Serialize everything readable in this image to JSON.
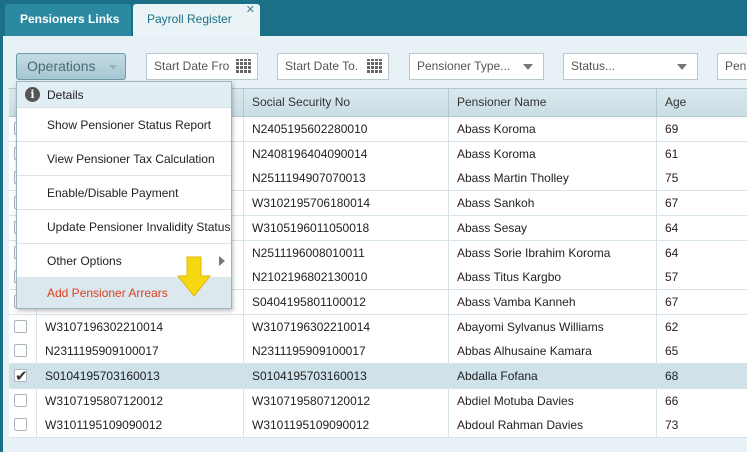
{
  "tabs": [
    {
      "label": "Pensioners Links"
    },
    {
      "label": "Payroll Register",
      "close": "✕"
    }
  ],
  "toolbar": {
    "operations_label": "Operations",
    "start_date_from_placeholder": "Start Date Fro",
    "start_date_to_placeholder": "Start Date To.",
    "pensioner_type_placeholder": "Pensioner Type...",
    "status_placeholder": "Status...",
    "last_field_placeholder": "Pens"
  },
  "grid": {
    "columns": [
      "Social Security No",
      "Pensioner Name",
      "Age"
    ],
    "rows": [
      {
        "ref": "",
        "ssn": "N2405195602280010",
        "name": "Abass Koroma",
        "age": "69",
        "checked": false
      },
      {
        "ref": "",
        "ssn": "N2408196404090014",
        "name": "Abass Koroma",
        "age": "61",
        "checked": false
      },
      {
        "ref": "",
        "ssn": "N2511194907070013",
        "name": "Abass Martin Tholley",
        "age": "75",
        "checked": false
      },
      {
        "ref": "",
        "ssn": "W3102195706180014",
        "name": "Abass Sankoh",
        "age": "67",
        "checked": false
      },
      {
        "ref": "",
        "ssn": "W3105196011050018",
        "name": "Abass Sesay",
        "age": "64",
        "checked": false
      },
      {
        "ref": "",
        "ssn": "N2511196008010011",
        "name": "Abass Sorie Ibrahim Koroma",
        "age": "64",
        "checked": false
      },
      {
        "ref": "",
        "ssn": "N2102196802130010",
        "name": "Abass Titus Kargbo",
        "age": "57",
        "checked": false
      },
      {
        "ref": "S0404195801100012",
        "ssn": "S0404195801100012",
        "name": "Abass Vamba Kanneh",
        "age": "67",
        "checked": false
      },
      {
        "ref": "W3107196302210014",
        "ssn": "W3107196302210014",
        "name": "Abayomi Sylvanus Williams",
        "age": "62",
        "checked": false
      },
      {
        "ref": "N2311195909100017",
        "ssn": "N2311195909100017",
        "name": "Abbas Alhusaine Kamara",
        "age": "65",
        "checked": false
      },
      {
        "ref": "S0104195703160013",
        "ssn": "S0104195703160013",
        "name": "Abdalla Fofana",
        "age": "68",
        "checked": true
      },
      {
        "ref": "W3107195807120012",
        "ssn": "W3107195807120012",
        "name": "Abdiel Motuba Davies",
        "age": "66",
        "checked": false
      },
      {
        "ref": "W3101195109090012",
        "ssn": "W3101195109090012",
        "name": "Abdoul Rahman Davies",
        "age": "73",
        "checked": false
      }
    ]
  },
  "menu": {
    "items": [
      {
        "label": "Details",
        "icon": "info-icon"
      },
      {
        "label": "Show Pensioner Status Report"
      },
      {
        "label": "View Pensioner Tax Calculation"
      },
      {
        "label": "Enable/Disable Payment"
      },
      {
        "label": "Update Pensioner Invalidity Status"
      },
      {
        "label": "Other Options",
        "submenu": true
      },
      {
        "label": "Add Pensioner Arrears",
        "highlight_color": "#e0401f"
      }
    ]
  },
  "colors": {
    "accent": "#1b6f86",
    "highlight_text": "#e0401f",
    "pointer_arrow": "#f5d712"
  }
}
